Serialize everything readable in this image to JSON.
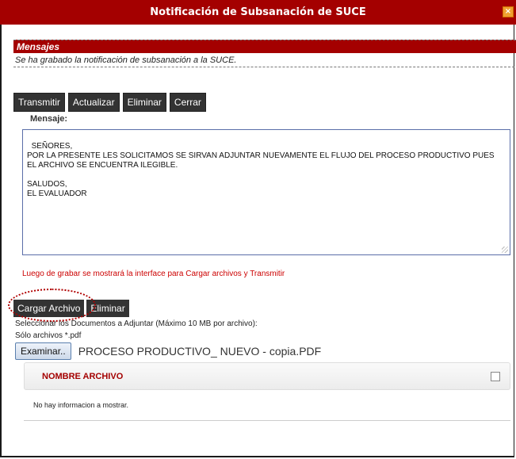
{
  "window": {
    "title": "Notificación de Subsanación de SUCE",
    "close_glyph": "×"
  },
  "messages": {
    "header": "Mensajes",
    "text": "Se ha grabado la notificación de subsanación a la SUCE."
  },
  "toolbar": {
    "transmit": "Transmitir",
    "update": "Actualizar",
    "delete": "Eliminar",
    "close": "Cerrar"
  },
  "message_field": {
    "label": "Mensaje:",
    "value": "SEÑORES,\nPOR LA PRESENTE LES SOLICITAMOS SE SIRVAN ADJUNTAR NUEVAMENTE EL FLUJO DEL PROCESO PRODUCTIVO PUES\nEL ARCHIVO SE ENCUENTRA ILEGIBLE.\n\nSALUDOS,\nEL EVALUADOR"
  },
  "hint": "Luego de grabar se mostrará la interface para Cargar archivos y Transmitir",
  "upload": {
    "load_button": "Cargar Archivo",
    "delete_button": "Eliminar",
    "instructions": "Seleccionar los Documentos a Adjuntar (Máximo 10 MB por archivo):",
    "only_pdf": "Sólo archivos *.pdf",
    "browse_button": "Examinar..",
    "selected_file": "PROCESO PRODUCTIVO_ NUEVO - copia.PDF"
  },
  "files_table": {
    "column": "NOMBRE ARCHIVO",
    "empty": "No hay informacion a mostrar."
  },
  "colors": {
    "accent": "#a40000",
    "button": "#333333"
  }
}
